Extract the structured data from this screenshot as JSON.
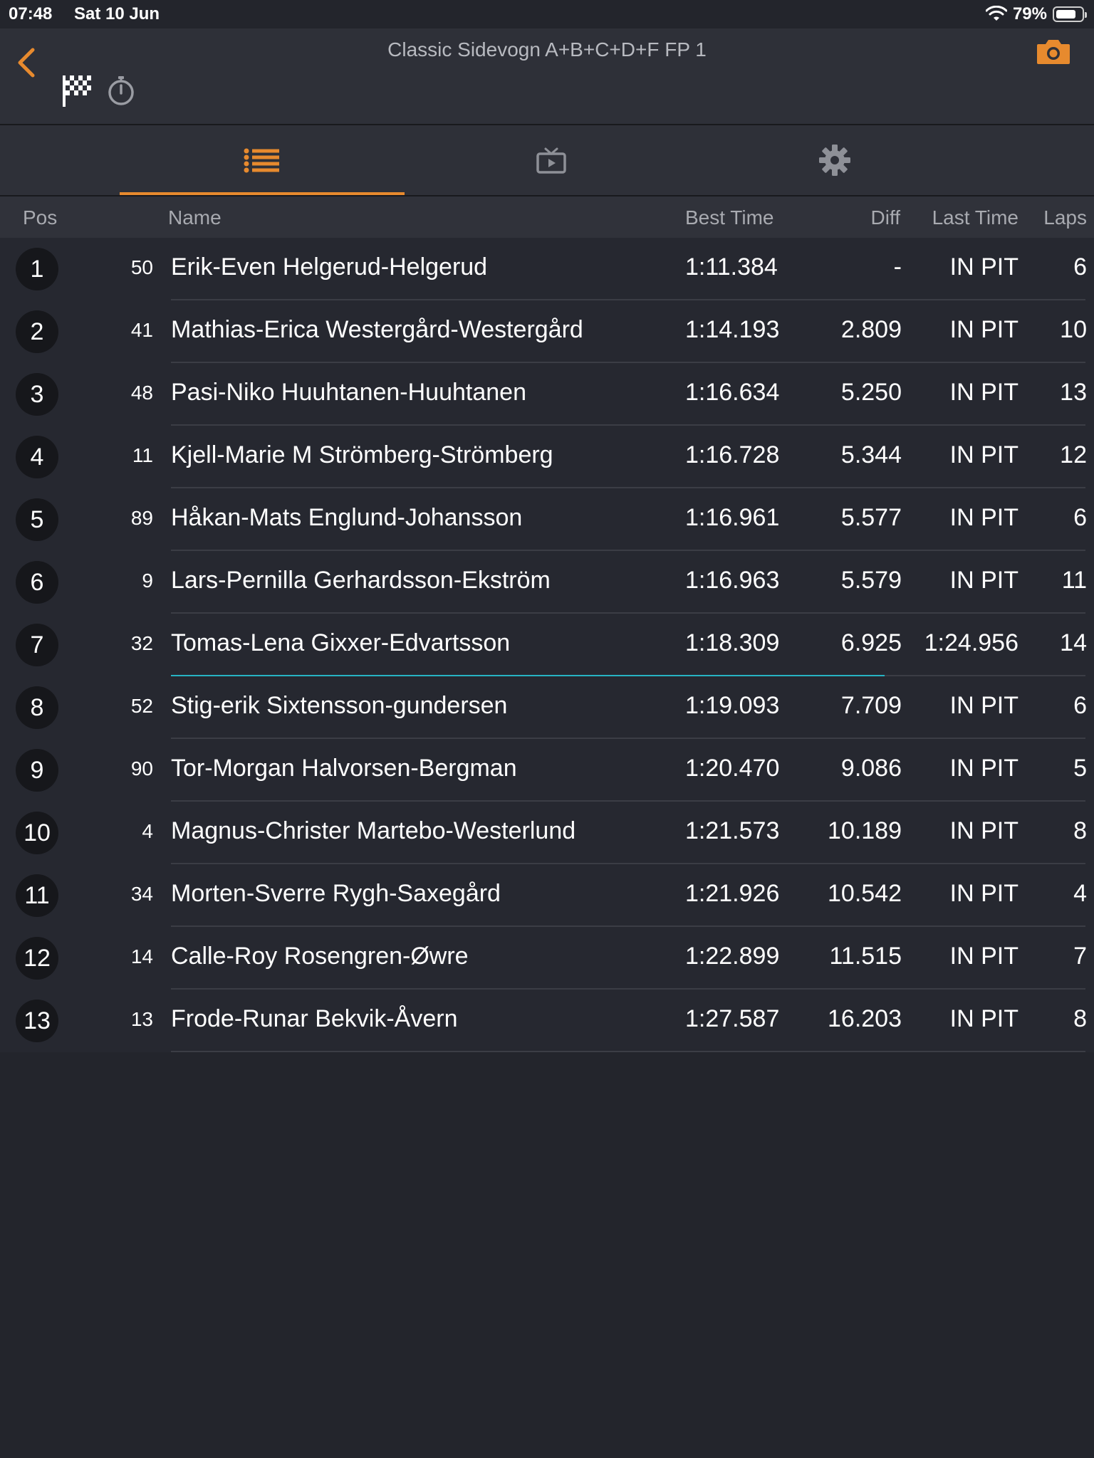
{
  "status_bar": {
    "time": "07:48",
    "date": "Sat 10 Jun",
    "battery": "79%",
    "battery_level": 0.79
  },
  "header": {
    "title": "Classic Sidevogn A+B+C+D+F FP 1",
    "back_icon": "chevron-left-icon",
    "flag_icon": "checkered-flag-icon",
    "stopwatch_icon": "stopwatch-icon",
    "camera_icon": "camera-icon"
  },
  "tabs": [
    {
      "icon": "list-icon",
      "active": true
    },
    {
      "icon": "tv-icon",
      "active": false
    },
    {
      "icon": "gear-icon",
      "active": false
    }
  ],
  "columns": {
    "pos": "Pos",
    "name": "Name",
    "best": "Best Time",
    "diff": "Diff",
    "last": "Last Time",
    "laps": "Laps"
  },
  "colors": {
    "accent": "#e78a2e",
    "progress": "#27b3c4",
    "background": "#23252c"
  },
  "rows": [
    {
      "pos": "1",
      "num": "50",
      "name": "Erik-Even Helgerud-Helgerud",
      "best": "1:11.384",
      "diff": "-",
      "last": "IN PIT",
      "laps": "6"
    },
    {
      "pos": "2",
      "num": "41",
      "name": "Mathias-Erica Westergård-Westergård",
      "best": "1:14.193",
      "diff": "2.809",
      "last": "IN PIT",
      "laps": "10"
    },
    {
      "pos": "3",
      "num": "48",
      "name": "Pasi-Niko Huuhtanen-Huuhtanen",
      "best": "1:16.634",
      "diff": "5.250",
      "last": "IN PIT",
      "laps": "13"
    },
    {
      "pos": "4",
      "num": "11",
      "name": "Kjell-Marie M Strömberg-Strömberg",
      "best": "1:16.728",
      "diff": "5.344",
      "last": "IN PIT",
      "laps": "12"
    },
    {
      "pos": "5",
      "num": "89",
      "name": "Håkan-Mats Englund-Johansson",
      "best": "1:16.961",
      "diff": "5.577",
      "last": "IN PIT",
      "laps": "6"
    },
    {
      "pos": "6",
      "num": "9",
      "name": "Lars-Pernilla Gerhardsson-Ekström",
      "best": "1:16.963",
      "diff": "5.579",
      "last": "IN PIT",
      "laps": "11"
    },
    {
      "pos": "7",
      "num": "32",
      "name": "Tomas-Lena Gixxer-Edvartsson",
      "best": "1:18.309",
      "diff": "6.925",
      "last": "1:24.956",
      "laps": "14",
      "lap_progress": 0.78
    },
    {
      "pos": "8",
      "num": "52",
      "name": "Stig-erik Sixtensson-gundersen",
      "best": "1:19.093",
      "diff": "7.709",
      "last": "IN PIT",
      "laps": "6"
    },
    {
      "pos": "9",
      "num": "90",
      "name": "Tor-Morgan Halvorsen-Bergman",
      "best": "1:20.470",
      "diff": "9.086",
      "last": "IN PIT",
      "laps": "5"
    },
    {
      "pos": "10",
      "num": "4",
      "name": "Magnus-Christer Martebo-Westerlund",
      "best": "1:21.573",
      "diff": "10.189",
      "last": "IN PIT",
      "laps": "8"
    },
    {
      "pos": "11",
      "num": "34",
      "name": "Morten-Sverre Rygh-Saxegård",
      "best": "1:21.926",
      "diff": "10.542",
      "last": "IN PIT",
      "laps": "4"
    },
    {
      "pos": "12",
      "num": "14",
      "name": "Calle-Roy Rosengren-Øwre",
      "best": "1:22.899",
      "diff": "11.515",
      "last": "IN PIT",
      "laps": "7"
    },
    {
      "pos": "13",
      "num": "13",
      "name": "Frode-Runar Bekvik-Åvern",
      "best": "1:27.587",
      "diff": "16.203",
      "last": "IN PIT",
      "laps": "8"
    }
  ]
}
